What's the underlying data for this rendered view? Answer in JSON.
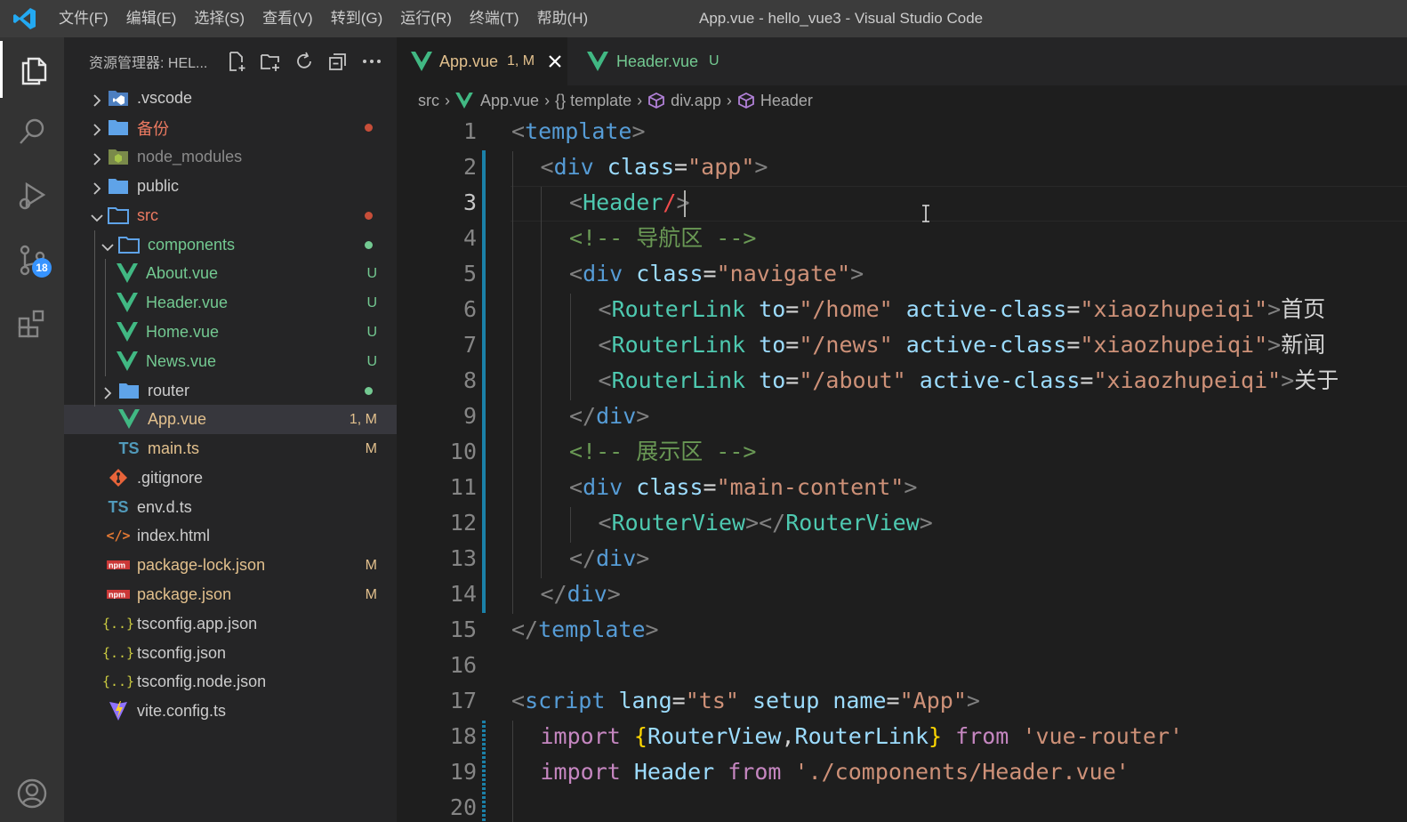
{
  "titlebar": {
    "menu": [
      "文件(F)",
      "编辑(E)",
      "选择(S)",
      "查看(V)",
      "转到(G)",
      "运行(R)",
      "终端(T)",
      "帮助(H)"
    ],
    "window_title": "App.vue - hello_vue3 - Visual Studio Code"
  },
  "activity": {
    "source_control_badge": "18"
  },
  "explorer": {
    "title": "资源管理器: HEL...",
    "items": [
      {
        "label": ".vscode",
        "kind": "folder",
        "decoration": ""
      },
      {
        "label": "备份",
        "kind": "folder",
        "decoration": "dot"
      },
      {
        "label": "node_modules",
        "kind": "folder",
        "decoration": ""
      },
      {
        "label": "public",
        "kind": "folder",
        "decoration": ""
      },
      {
        "label": "src",
        "kind": "folder",
        "decoration": "dot"
      },
      {
        "label": "components",
        "kind": "folder",
        "decoration": "dot"
      },
      {
        "label": "About.vue",
        "kind": "vue",
        "decoration": "U"
      },
      {
        "label": "Header.vue",
        "kind": "vue",
        "decoration": "U"
      },
      {
        "label": "Home.vue",
        "kind": "vue",
        "decoration": "U"
      },
      {
        "label": "News.vue",
        "kind": "vue",
        "decoration": "U"
      },
      {
        "label": "router",
        "kind": "folder",
        "decoration": "dot"
      },
      {
        "label": "App.vue",
        "kind": "vue",
        "decoration": "1, M"
      },
      {
        "label": "main.ts",
        "kind": "ts",
        "decoration": "M"
      },
      {
        "label": ".gitignore",
        "kind": "git",
        "decoration": ""
      },
      {
        "label": "env.d.ts",
        "kind": "ts",
        "decoration": ""
      },
      {
        "label": "index.html",
        "kind": "html",
        "decoration": ""
      },
      {
        "label": "package-lock.json",
        "kind": "npm",
        "decoration": "M"
      },
      {
        "label": "package.json",
        "kind": "npm",
        "decoration": "M"
      },
      {
        "label": "tsconfig.app.json",
        "kind": "json",
        "decoration": ""
      },
      {
        "label": "tsconfig.json",
        "kind": "json",
        "decoration": ""
      },
      {
        "label": "tsconfig.node.json",
        "kind": "json",
        "decoration": ""
      },
      {
        "label": "vite.config.ts",
        "kind": "vite",
        "decoration": ""
      }
    ]
  },
  "tabs": [
    {
      "label": "App.vue",
      "status": "1, M",
      "active": true
    },
    {
      "label": "Header.vue",
      "status": "U",
      "active": false
    }
  ],
  "breadcrumb": [
    "src",
    "App.vue",
    "{} template",
    "div.app",
    "Header"
  ],
  "editor": {
    "current_line": 3,
    "lines": [
      {
        "n": "1",
        "tokens": [
          [
            "<",
            "p"
          ],
          [
            "template",
            "tag"
          ],
          [
            ">",
            "p"
          ]
        ]
      },
      {
        "n": "2",
        "tokens": [
          [
            "<",
            "p"
          ],
          [
            "div",
            "tag"
          ],
          [
            " ",
            "txt"
          ],
          [
            "class",
            "attr"
          ],
          [
            "=",
            "txt"
          ],
          [
            "\"app\"",
            "str"
          ],
          [
            ">",
            "p"
          ]
        ]
      },
      {
        "n": "3",
        "tokens": [
          [
            "<",
            "p"
          ],
          [
            "Header",
            "comp"
          ],
          [
            "/",
            "red"
          ],
          [
            ">",
            "p"
          ]
        ]
      },
      {
        "n": "4",
        "tokens": [
          [
            "<!-- 导航区 -->",
            "com"
          ]
        ]
      },
      {
        "n": "5",
        "tokens": [
          [
            "<",
            "p"
          ],
          [
            "div",
            "tag"
          ],
          [
            " ",
            "txt"
          ],
          [
            "class",
            "attr"
          ],
          [
            "=",
            "txt"
          ],
          [
            "\"navigate\"",
            "str"
          ],
          [
            ">",
            "p"
          ]
        ]
      },
      {
        "n": "6",
        "tokens": [
          [
            "<",
            "p"
          ],
          [
            "RouterLink",
            "comp"
          ],
          [
            " ",
            "txt"
          ],
          [
            "to",
            "attr"
          ],
          [
            "=",
            "txt"
          ],
          [
            "\"/home\"",
            "str"
          ],
          [
            " ",
            "txt"
          ],
          [
            "active-class",
            "attr"
          ],
          [
            "=",
            "txt"
          ],
          [
            "\"xiaozhupeiqi\"",
            "str"
          ],
          [
            ">",
            "p"
          ],
          [
            "首页",
            "txt"
          ]
        ]
      },
      {
        "n": "7",
        "tokens": [
          [
            "<",
            "p"
          ],
          [
            "RouterLink",
            "comp"
          ],
          [
            " ",
            "txt"
          ],
          [
            "to",
            "attr"
          ],
          [
            "=",
            "txt"
          ],
          [
            "\"/news\"",
            "str"
          ],
          [
            " ",
            "txt"
          ],
          [
            "active-class",
            "attr"
          ],
          [
            "=",
            "txt"
          ],
          [
            "\"xiaozhupeiqi\"",
            "str"
          ],
          [
            ">",
            "p"
          ],
          [
            "新闻",
            "txt"
          ]
        ]
      },
      {
        "n": "8",
        "tokens": [
          [
            "<",
            "p"
          ],
          [
            "RouterLink",
            "comp"
          ],
          [
            " ",
            "txt"
          ],
          [
            "to",
            "attr"
          ],
          [
            "=",
            "txt"
          ],
          [
            "\"/about\"",
            "str"
          ],
          [
            " ",
            "txt"
          ],
          [
            "active-class",
            "attr"
          ],
          [
            "=",
            "txt"
          ],
          [
            "\"xiaozhupeiqi\"",
            "str"
          ],
          [
            ">",
            "p"
          ],
          [
            "关于",
            "txt"
          ]
        ]
      },
      {
        "n": "9",
        "tokens": [
          [
            "</",
            "p"
          ],
          [
            "div",
            "tag"
          ],
          [
            ">",
            "p"
          ]
        ]
      },
      {
        "n": "10",
        "tokens": [
          [
            "<!-- 展示区 -->",
            "com"
          ]
        ]
      },
      {
        "n": "11",
        "tokens": [
          [
            "<",
            "p"
          ],
          [
            "div",
            "tag"
          ],
          [
            " ",
            "txt"
          ],
          [
            "class",
            "attr"
          ],
          [
            "=",
            "txt"
          ],
          [
            "\"main-content\"",
            "str"
          ],
          [
            ">",
            "p"
          ]
        ]
      },
      {
        "n": "12",
        "tokens": [
          [
            "<",
            "p"
          ],
          [
            "RouterView",
            "comp"
          ],
          [
            "></",
            "p"
          ],
          [
            "RouterView",
            "comp"
          ],
          [
            ">",
            "p"
          ]
        ]
      },
      {
        "n": "13",
        "tokens": [
          [
            "</",
            "p"
          ],
          [
            "div",
            "tag"
          ],
          [
            ">",
            "p"
          ]
        ]
      },
      {
        "n": "14",
        "tokens": [
          [
            "</",
            "p"
          ],
          [
            "div",
            "tag"
          ],
          [
            ">",
            "p"
          ]
        ]
      },
      {
        "n": "15",
        "tokens": [
          [
            "</",
            "p"
          ],
          [
            "template",
            "tag"
          ],
          [
            ">",
            "p"
          ]
        ]
      },
      {
        "n": "16",
        "tokens": []
      },
      {
        "n": "17",
        "tokens": [
          [
            "<",
            "p"
          ],
          [
            "script",
            "tag"
          ],
          [
            " ",
            "txt"
          ],
          [
            "lang",
            "attr"
          ],
          [
            "=",
            "txt"
          ],
          [
            "\"ts\"",
            "str"
          ],
          [
            " ",
            "txt"
          ],
          [
            "setup",
            "attr"
          ],
          [
            " ",
            "txt"
          ],
          [
            "name",
            "attr"
          ],
          [
            "=",
            "txt"
          ],
          [
            "\"App\"",
            "str"
          ],
          [
            ">",
            "p"
          ]
        ]
      },
      {
        "n": "18",
        "tokens": [
          [
            "import",
            "kw"
          ],
          [
            " ",
            "txt"
          ],
          [
            "{",
            "br"
          ],
          [
            "RouterView",
            "attr"
          ],
          [
            ",",
            "txt"
          ],
          [
            "RouterLink",
            "attr"
          ],
          [
            "}",
            "br"
          ],
          [
            " ",
            "txt"
          ],
          [
            "from",
            "kw"
          ],
          [
            " ",
            "txt"
          ],
          [
            "'vue-router'",
            "str"
          ]
        ]
      },
      {
        "n": "19",
        "tokens": [
          [
            "import",
            "kw"
          ],
          [
            " ",
            "txt"
          ],
          [
            "Header",
            "attr"
          ],
          [
            " ",
            "txt"
          ],
          [
            "from",
            "kw"
          ],
          [
            " ",
            "txt"
          ],
          [
            "'./components/Header.vue'",
            "str"
          ]
        ]
      },
      {
        "n": "20",
        "tokens": []
      }
    ]
  },
  "colors": {
    "accent": "#007acc",
    "untracked": "#73c991",
    "modified": "#e2c08d",
    "conflict": "#c74e39",
    "vue_green": "#41b883"
  }
}
